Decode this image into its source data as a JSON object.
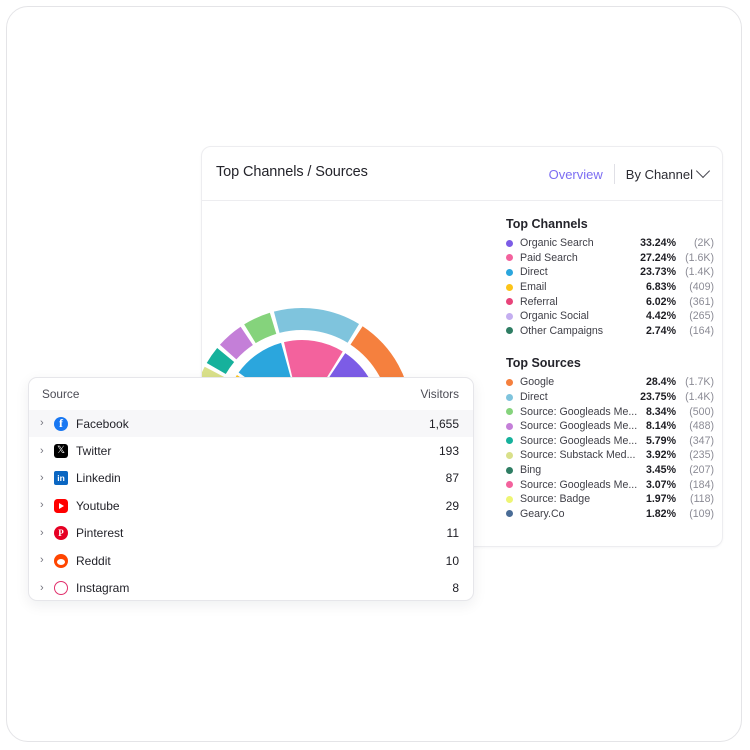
{
  "card": {
    "title": "Top Channels / Sources",
    "tab_overview": "Overview",
    "select_label": "By Channel"
  },
  "top_channels": {
    "heading": "Top Channels",
    "rows": [
      {
        "label": "Organic Search",
        "pct": "33.24%",
        "count": "(2K)",
        "color": "#7c5ce6"
      },
      {
        "label": "Paid Search",
        "pct": "27.24%",
        "count": "(1.6K)",
        "color": "#f3629d"
      },
      {
        "label": "Direct",
        "pct": "23.73%",
        "count": "(1.4K)",
        "color": "#2ba6dd"
      },
      {
        "label": "Email",
        "pct": "6.83%",
        "count": "(409)",
        "color": "#fcc418"
      },
      {
        "label": "Referral",
        "pct": "6.02%",
        "count": "(361)",
        "color": "#e8447a"
      },
      {
        "label": "Organic Social",
        "pct": "4.42%",
        "count": "(265)",
        "color": "#c4aef0"
      },
      {
        "label": "Other Campaigns",
        "pct": "2.74%",
        "count": "(164)",
        "color": "#2e7d63"
      }
    ]
  },
  "top_sources": {
    "heading": "Top Sources",
    "rows": [
      {
        "label": "Google",
        "pct": "28.4%",
        "count": "(1.7K)",
        "color": "#f5803e"
      },
      {
        "label": "Direct",
        "pct": "23.75%",
        "count": "(1.4K)",
        "color": "#7fc4dd"
      },
      {
        "label": "Source: Googleads Me...",
        "pct": "8.34%",
        "count": "(500)",
        "color": "#85d37c"
      },
      {
        "label": "Source: Googleads Me...",
        "pct": "8.14%",
        "count": "(488)",
        "color": "#c47fd8"
      },
      {
        "label": "Source: Googleads Me...",
        "pct": "5.79%",
        "count": "(347)",
        "color": "#16b19c"
      },
      {
        "label": "Source: Substack Med...",
        "pct": "3.92%",
        "count": "(235)",
        "color": "#d9e08a"
      },
      {
        "label": "Bing",
        "pct": "3.45%",
        "count": "(207)",
        "color": "#2e7d63"
      },
      {
        "label": "Source: Googleads Me...",
        "pct": "3.07%",
        "count": "(184)",
        "color": "#f3629d"
      },
      {
        "label": "Source: Badge",
        "pct": "1.97%",
        "count": "(118)",
        "color": "#eef574"
      },
      {
        "label": "Geary.Co",
        "pct": "1.82%",
        "count": "(109)",
        "color": "#4a6c96"
      }
    ]
  },
  "table": {
    "col_source": "Source",
    "col_visitors": "Visitors",
    "caret": "›",
    "rows": [
      {
        "name": "Facebook",
        "visitors": "1,655",
        "icon": "facebook-icon",
        "icon_class": "ic-fb"
      },
      {
        "name": "Twitter",
        "visitors": "193",
        "icon": "twitter-x-icon",
        "icon_class": "ic-tw"
      },
      {
        "name": "Linkedin",
        "visitors": "87",
        "icon": "linkedin-icon",
        "icon_class": "ic-li"
      },
      {
        "name": "Youtube",
        "visitors": "29",
        "icon": "youtube-icon",
        "icon_class": "ic-yt"
      },
      {
        "name": "Pinterest",
        "visitors": "11",
        "icon": "pinterest-icon",
        "icon_class": "ic-pi"
      },
      {
        "name": "Reddit",
        "visitors": "10",
        "icon": "reddit-icon",
        "icon_class": "ic-rd"
      },
      {
        "name": "Instagram",
        "visitors": "8",
        "icon": "instagram-icon",
        "icon_class": "ic-ig"
      }
    ]
  },
  "chart_data": {
    "type": "pie",
    "title": "Top Channels / Sources",
    "variant": "half-donut-two-ring",
    "start_angle_deg": 180,
    "sweep_deg": 180,
    "rings": [
      {
        "name": "Top Sources",
        "radius_inner": 88,
        "radius_outer": 110,
        "categories": [
          "Google",
          "Direct",
          "Source: Googleads Me...",
          "Source: Googleads Me...",
          "Source: Googleads Me...",
          "Source: Substack Med...",
          "Bing",
          "Source: Googleads Me...",
          "Source: Badge",
          "Geary.Co"
        ],
        "values": [
          28.4,
          23.75,
          8.34,
          8.14,
          5.79,
          3.92,
          3.45,
          3.07,
          1.97,
          1.82
        ],
        "counts": [
          1700,
          1400,
          500,
          488,
          347,
          235,
          207,
          184,
          118,
          109
        ],
        "colors": [
          "#f5803e",
          "#7fc4dd",
          "#85d37c",
          "#c47fd8",
          "#16b19c",
          "#d9e08a",
          "#2e7d63",
          "#f3629d",
          "#eef574",
          "#4a6c96"
        ]
      },
      {
        "name": "Top Channels",
        "radius_inner": 38,
        "radius_outer": 78,
        "categories": [
          "Organic Search",
          "Paid Search",
          "Direct",
          "Email",
          "Referral",
          "Organic Social",
          "Other Campaigns"
        ],
        "values": [
          33.24,
          27.24,
          23.73,
          6.83,
          6.02,
          4.42,
          2.74
        ],
        "counts": [
          2000,
          1600,
          1400,
          409,
          361,
          265,
          164
        ],
        "colors": [
          "#7c5ce6",
          "#f3629d",
          "#2ba6dd",
          "#fcc418",
          "#e8447a",
          "#c4aef0",
          "#2e7d63"
        ]
      }
    ],
    "legend_position": "right",
    "grid": false
  }
}
